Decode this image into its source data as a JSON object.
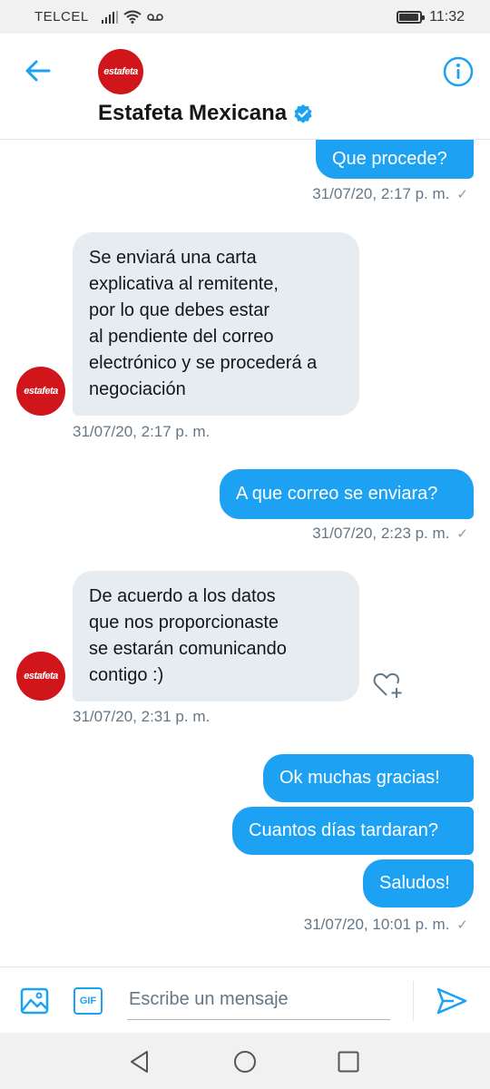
{
  "status_bar": {
    "carrier": "TELCEL",
    "time": "11:32",
    "battery_level": 0.85
  },
  "header": {
    "title": "Estafeta Mexicana",
    "logo_text": "estafeta"
  },
  "messages": [
    {
      "direction": "out",
      "text": "Que procede?"
    },
    {
      "timestamp": "31/07/20, 2:17 p. m.",
      "read_mark": "✓"
    },
    {
      "direction": "in",
      "lines": [
        "Se enviará una carta",
        "explicativa al remitente,",
        "por lo que debes estar",
        "al pendiente del correo",
        "electrónico y se procederá a",
        "negociación"
      ]
    },
    {
      "timestamp": "31/07/20, 2:17 p. m."
    },
    {
      "direction": "out",
      "text": "A que correo se enviara?"
    },
    {
      "timestamp": "31/07/20, 2:23 p. m.",
      "read_mark": "✓"
    },
    {
      "direction": "in",
      "lines": [
        "De acuerdo a los datos",
        "que nos proporcionaste",
        "se estarán comunicando",
        "contigo :)"
      ]
    },
    {
      "timestamp": "31/07/20, 2:31 p. m."
    },
    {
      "direction": "out",
      "text": "Ok muchas gracias!"
    },
    {
      "direction": "out",
      "text": "Cuantos días tardaran?"
    },
    {
      "direction": "out",
      "text": "Saludos!"
    },
    {
      "timestamp": "31/07/20, 10:01 p. m.",
      "read_mark": "✓"
    }
  ],
  "composer": {
    "placeholder": "Escribe un mensaje",
    "gif_label": "GIF"
  },
  "colors": {
    "accent": "#1da1f2",
    "brand_red": "#d0161b",
    "incoming_bubble": "#e6ecf0"
  }
}
